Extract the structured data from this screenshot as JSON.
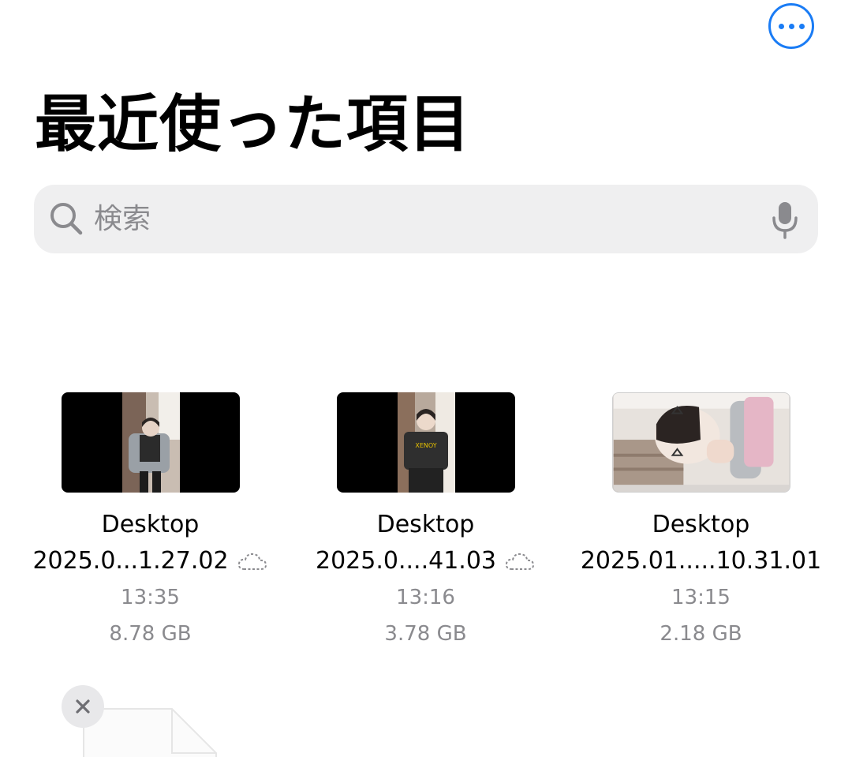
{
  "header": {
    "more_icon": "ellipsis-circle-icon",
    "title": "最近使った項目"
  },
  "search": {
    "placeholder": "検索",
    "search_icon": "magnifier-icon",
    "mic_icon": "microphone-icon"
  },
  "files": [
    {
      "name": "Desktop",
      "subtitle": "2025.0...1.27.02",
      "cloud": true,
      "time": "13:35",
      "size": "8.78 GB"
    },
    {
      "name": "Desktop",
      "subtitle": "2025.0....41.03",
      "cloud": true,
      "time": "13:16",
      "size": "3.78 GB"
    },
    {
      "name": "Desktop",
      "subtitle": "2025.01.....10.31.01",
      "cloud": false,
      "time": "13:15",
      "size": "2.18 GB"
    }
  ],
  "colors": {
    "accent": "#1a7cf5",
    "secondary_text": "#8a8a8e",
    "search_bg": "#efeff0"
  }
}
